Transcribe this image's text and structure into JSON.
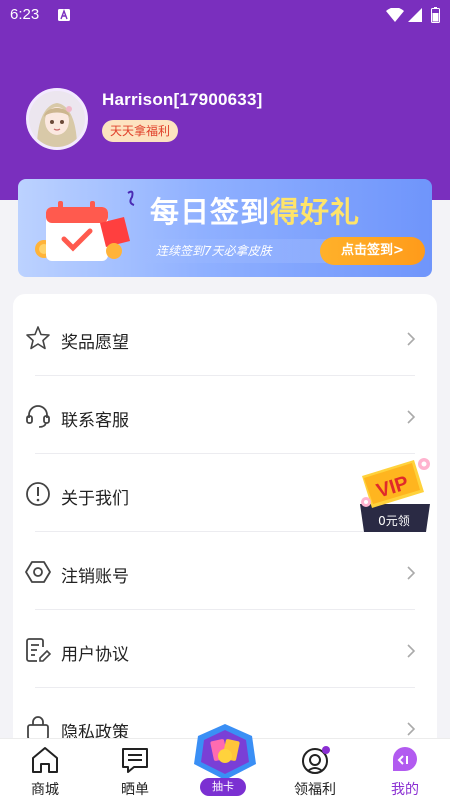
{
  "status_bar": {
    "time": "6:23"
  },
  "profile": {
    "username": "Harrison[17900633]",
    "badge": "天天拿福利"
  },
  "banner": {
    "title_part1": "每日签到",
    "title_part2": "得好礼",
    "subtitle": "连续签到7天必拿皮肤",
    "button": "点击签到>"
  },
  "menu": [
    {
      "label": "奖品愿望",
      "icon": "star-icon"
    },
    {
      "label": "联系客服",
      "icon": "headset-icon"
    },
    {
      "label": "关于我们",
      "icon": "info-icon"
    },
    {
      "label": "注销账号",
      "icon": "hexagon-icon"
    },
    {
      "label": "用户协议",
      "icon": "document-edit-icon"
    },
    {
      "label": "隐私政策",
      "icon": "lock-icon"
    }
  ],
  "vip_float": {
    "badge": "VIP",
    "price": "0元领"
  },
  "tabbar": {
    "tabs": [
      {
        "label": "商城",
        "icon": "home-icon"
      },
      {
        "label": "晒单",
        "icon": "chat-list-icon"
      },
      {
        "label": "抽卡",
        "icon": "card-draw-icon"
      },
      {
        "label": "领福利",
        "icon": "gift-face-icon"
      },
      {
        "label": "我的",
        "icon": "profile-chat-icon"
      }
    ],
    "active": "我的"
  },
  "colors": {
    "header": "#7a2fbe",
    "accent": "#8a2ed2",
    "badge_text": "#e0402a",
    "banner_button": "#ff9b1a"
  }
}
